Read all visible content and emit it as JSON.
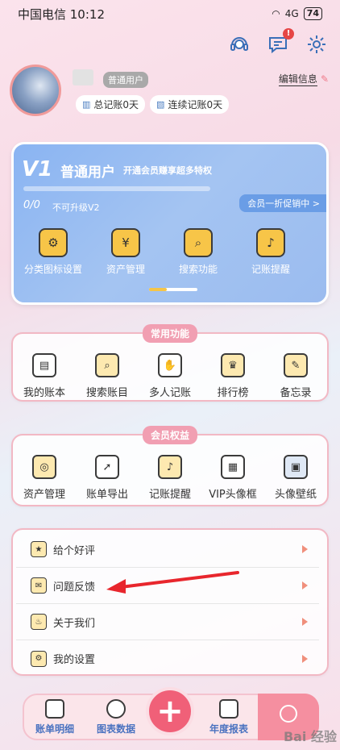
{
  "status": {
    "carrier_time": "中国电信 10:12",
    "signal": "4G",
    "battery": "74"
  },
  "header": {
    "notify_badge": "!"
  },
  "profile": {
    "level_tag": "普通用户",
    "edit_label": "编辑信息",
    "total_days": "总记账0天",
    "streak_days": "连续记账0天"
  },
  "vip": {
    "level": "V1",
    "title": "普通用户",
    "subtitle": "开通会员赚享超多特权",
    "progress": "0/0",
    "upgrade": "不可升级V2",
    "promo": "会员一折促销中 >",
    "items": [
      {
        "label": "分类图标设置",
        "icon": "gear-icon",
        "glyph": "⚙"
      },
      {
        "label": "资产管理",
        "icon": "money-bag-icon",
        "glyph": "¥"
      },
      {
        "label": "搜索功能",
        "icon": "search-doc-icon",
        "glyph": "⌕"
      },
      {
        "label": "记账提醒",
        "icon": "bell-icon",
        "glyph": "♪"
      }
    ]
  },
  "common": {
    "title": "常用功能",
    "items": [
      {
        "label": "我的账本",
        "icon": "ledger-icon",
        "glyph": "▤",
        "color": "#ffffff"
      },
      {
        "label": "搜索账目",
        "icon": "search-ledger-icon",
        "glyph": "⌕",
        "color": "#fde9b0"
      },
      {
        "label": "多人记账",
        "icon": "handshake-icon",
        "glyph": "✋",
        "color": "#ffffff"
      },
      {
        "label": "排行榜",
        "icon": "trophy-icon",
        "glyph": "♛",
        "color": "#fde9b0"
      },
      {
        "label": "备忘录",
        "icon": "memo-icon",
        "glyph": "✎",
        "color": "#fde9b0"
      }
    ]
  },
  "member": {
    "title": "会员权益",
    "items": [
      {
        "label": "资产管理",
        "icon": "asset-icon",
        "glyph": "◎",
        "color": "#fde9b0"
      },
      {
        "label": "账单导出",
        "icon": "export-icon",
        "glyph": "➚",
        "color": "#ffffff"
      },
      {
        "label": "记账提醒",
        "icon": "bell-icon",
        "glyph": "♪",
        "color": "#fde9b0"
      },
      {
        "label": "VIP头像框",
        "icon": "shop-icon",
        "glyph": "▦",
        "color": "#ffffff"
      },
      {
        "label": "头像壁纸",
        "icon": "wallpaper-icon",
        "glyph": "▣",
        "color": "#dfe8f5"
      }
    ]
  },
  "list": [
    {
      "label": "给个好评",
      "icon": "thumbs-up-icon",
      "glyph": "★"
    },
    {
      "label": "问题反馈",
      "icon": "microscope-icon",
      "glyph": "✉"
    },
    {
      "label": "关于我们",
      "icon": "lamp-icon",
      "glyph": "♨"
    },
    {
      "label": "我的设置",
      "icon": "settings-screen-icon",
      "glyph": "⚙"
    }
  ],
  "tabs": {
    "bills": "账单明细",
    "charts": "图表数据",
    "annual": "年度报表",
    "fab": "+"
  },
  "watermark": "Bai 经验"
}
